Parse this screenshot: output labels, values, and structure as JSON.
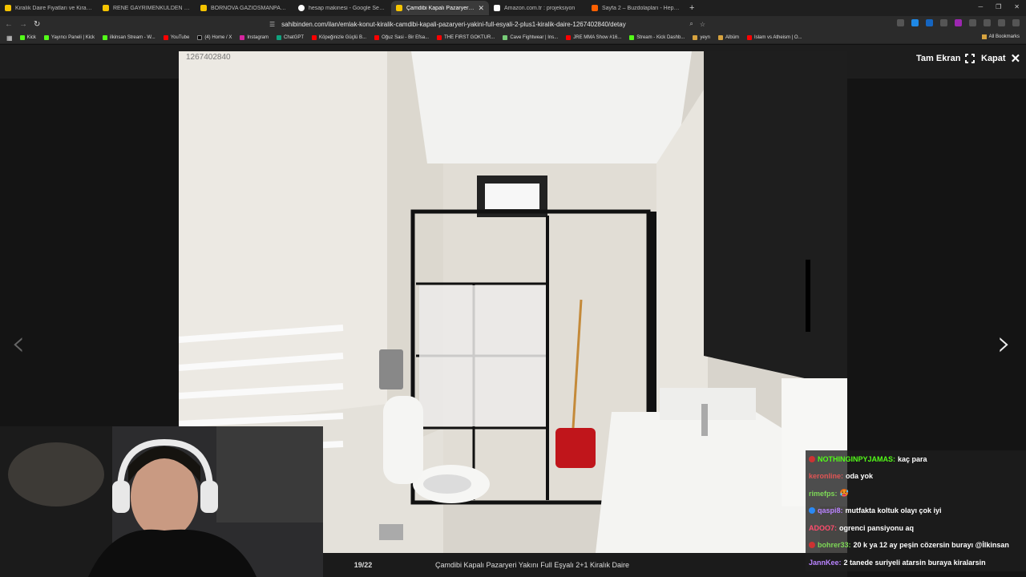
{
  "tabs": [
    {
      "title": "Kiralık Daire Fiyatları ve Kiralık Ev İlan",
      "favicon": "sahibinden-icon",
      "active": false
    },
    {
      "title": "RENE GAYRİMENKULDEN KİRALIK 2+",
      "favicon": "sahibinden-icon",
      "active": false
    },
    {
      "title": "BORNOVA GAZİOSMANPAŞA'DA KİR",
      "favicon": "sahibinden-icon",
      "active": false
    },
    {
      "title": "hesap makinesi - Google Search",
      "favicon": "google-icon",
      "active": false
    },
    {
      "title": "Çamdibi Kapalı Pazaryeri Yakını F",
      "favicon": "sahibinden-icon",
      "active": true
    },
    {
      "title": "Amazon.com.tr : projeksiyon",
      "favicon": "amazon-icon",
      "active": false
    },
    {
      "title": "Sayfa 2 – Buzdolapları - Hepsiburada",
      "favicon": "hepsiburada-icon",
      "active": false
    }
  ],
  "address_bar": {
    "url": "sahibinden.com/ilan/emlak-konut-kiralik-camdibi-kapali-pazaryeri-yakini-full-esyali-2-plus1-kiralik-daire-1267402840/detay"
  },
  "bookmarks": [
    {
      "label": "Kick",
      "icon": "kick-icon"
    },
    {
      "label": "Yayıncı Paneli | Kick",
      "icon": "kick-icon"
    },
    {
      "label": "ilkinsan Stream - W...",
      "icon": "kick-icon"
    },
    {
      "label": "YouTube",
      "icon": "youtube-icon"
    },
    {
      "label": "(4) Home / X",
      "icon": "x-icon"
    },
    {
      "label": "Instagram",
      "icon": "instagram-icon"
    },
    {
      "label": "ChatGPT",
      "icon": "chatgpt-icon"
    },
    {
      "label": "Köpeğinizle Güçlü B...",
      "icon": "youtube-icon"
    },
    {
      "label": "Oğuz Sasi - Bir Efsa...",
      "icon": "youtube-icon"
    },
    {
      "label": "THE FIRST GOKTUR...",
      "icon": "youtube-icon"
    },
    {
      "label": "Cave Fightwear | Ins...",
      "icon": "cave-icon"
    },
    {
      "label": "JRE MMA Show #16...",
      "icon": "youtube-icon"
    },
    {
      "label": "Stream - Kick Dashb...",
      "icon": "kick-icon"
    },
    {
      "label": "yeyn",
      "icon": "folder-icon"
    },
    {
      "label": "Albüm",
      "icon": "folder-icon"
    },
    {
      "label": "Islam vs Atheism | O...",
      "icon": "youtube-icon"
    }
  ],
  "all_bookmarks_label": "All Bookmarks",
  "viewer": {
    "listing_id": "1267402840",
    "fullscreen_label": "Tam Ekran",
    "close_label": "Kapat",
    "counter": "19/22",
    "title": "Çamdibi Kapalı Pazaryeri Yakını Full Eşyalı 2+1 Kiralık Daire"
  },
  "chat": [
    {
      "user": "NOTHINGINPYJAMAS:",
      "text": "kaç para",
      "color": "#53fc18",
      "badge": true
    },
    {
      "user": "keronline:",
      "text": "oda yok",
      "color": "#e05555",
      "badge": false
    },
    {
      "user": "rimefps:",
      "text": "🥵",
      "color": "#7ed957",
      "badge": false
    },
    {
      "user": "qaspi8:",
      "text": "mutfakta koltuk olayı çok iyi",
      "color": "#b983ff",
      "badge": true
    },
    {
      "user": "ADOO7:",
      "text": "ogrenci pansiyonu aq",
      "color": "#ff4d6d",
      "badge": false
    },
    {
      "user": "bohrer33:",
      "text": "20 k ya 12 ay peşin cözersin burayı @İlkinsan",
      "color": "#7ed957",
      "badge": true
    },
    {
      "user": "JannKee:",
      "text": "2 tanede suriyeli atarsin buraya kiralarsin",
      "color": "#b983ff",
      "badge": false
    }
  ],
  "colors": {
    "kick_green": "#53fc18",
    "background": "#141414"
  }
}
